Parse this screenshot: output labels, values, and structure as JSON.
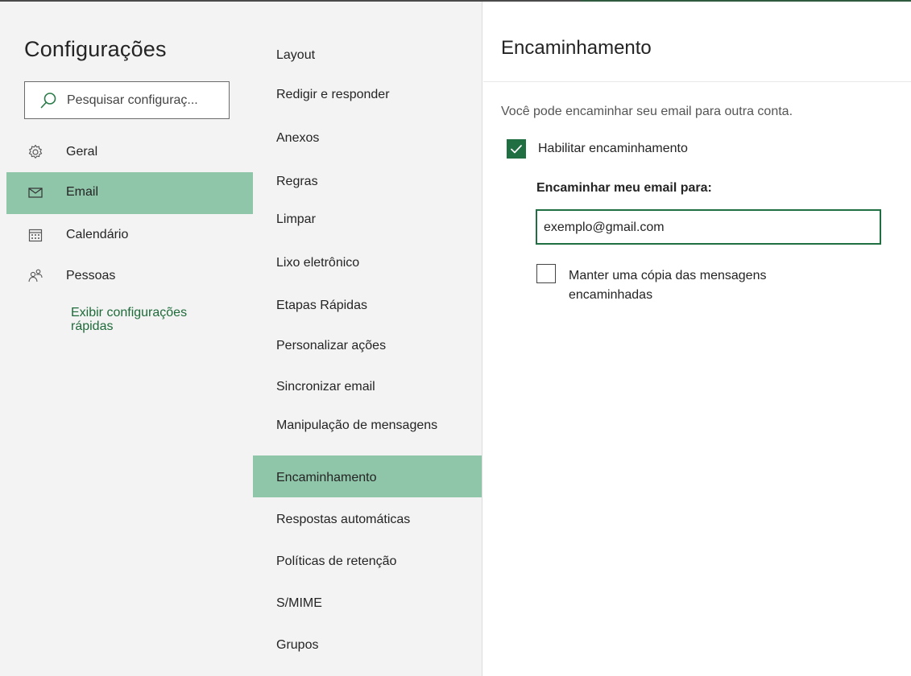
{
  "sidebar": {
    "title": "Configurações",
    "search_placeholder": "Pesquisar configuraç...",
    "items": [
      {
        "label": "Geral",
        "icon": "gear-icon"
      },
      {
        "label": "Email",
        "icon": "mail-icon",
        "active": true
      },
      {
        "label": "Calendário",
        "icon": "calendar-icon"
      },
      {
        "label": "Pessoas",
        "icon": "people-icon"
      }
    ],
    "quick_settings_link": "Exibir configurações rápidas"
  },
  "subnav": {
    "items": [
      {
        "label": "Layout"
      },
      {
        "label": "Redigir e responder"
      },
      {
        "label": "Anexos"
      },
      {
        "label": "Regras"
      },
      {
        "label": "Limpar"
      },
      {
        "label": "Lixo eletrônico"
      },
      {
        "label": "Etapas Rápidas"
      },
      {
        "label": "Personalizar ações"
      },
      {
        "label": "Sincronizar email"
      },
      {
        "label": "Manipulação de mensagens"
      },
      {
        "label": "Encaminhamento",
        "active": true
      },
      {
        "label": "Respostas automáticas"
      },
      {
        "label": "Políticas de retenção"
      },
      {
        "label": "S/MIME"
      },
      {
        "label": "Grupos"
      }
    ]
  },
  "panel": {
    "title": "Encaminhamento",
    "description": "Você pode encaminhar seu email para outra conta.",
    "enable_forwarding": {
      "label": "Habilitar encaminhamento",
      "checked": true
    },
    "forward_to_label": "Encaminhar meu email para:",
    "forward_to_value": "exemplo@gmail.com",
    "keep_copy": {
      "label": "Manter uma cópia das mensagens encaminhadas",
      "checked": false
    }
  },
  "colors": {
    "accent_green": "#1f6f43",
    "selected_bg": "#8fc5a9",
    "sidebar_bg": "#f3f3f3"
  }
}
